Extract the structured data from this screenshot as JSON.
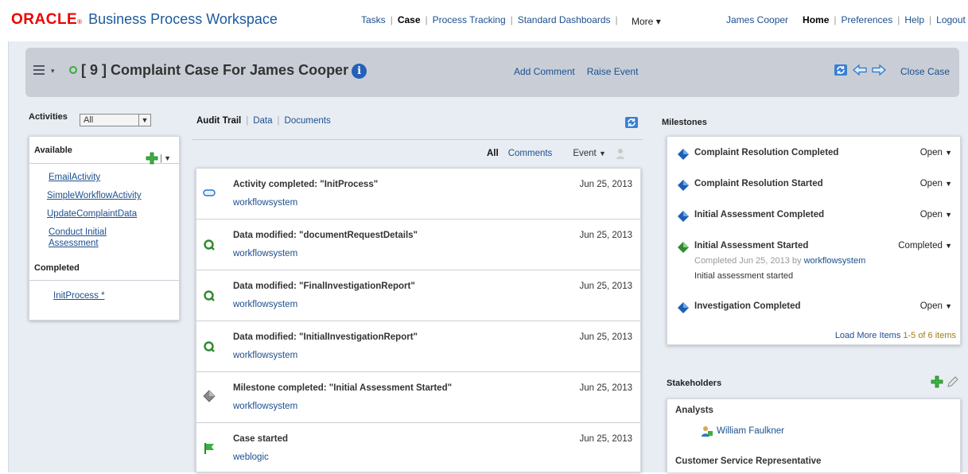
{
  "brand": {
    "oracle": "ORACLE",
    "product": "Business Process Workspace",
    "oracle_color": "#e00000"
  },
  "topnav": {
    "items": [
      "Tasks",
      "Case",
      "Process Tracking",
      "Standard Dashboards"
    ],
    "active": "Case",
    "more": "More"
  },
  "usernav": {
    "user": "James Cooper",
    "links": [
      "Home",
      "Preferences",
      "Help",
      "Logout"
    ]
  },
  "case": {
    "title": "[ 9 ] Complaint Case For James Cooper",
    "add_comment": "Add Comment",
    "raise_event": "Raise Event",
    "close_case": "Close Case"
  },
  "activities": {
    "label": "Activities",
    "filter": "All",
    "available_label": "Available",
    "available": [
      "EmailActivity",
      "SimpleWorkflowActivity",
      "UpdateComplaintData",
      "Conduct Initial Assessment"
    ],
    "completed_label": "Completed",
    "completed": [
      "InitProcess *"
    ]
  },
  "audit": {
    "tabs": [
      "Audit Trail",
      "Data",
      "Documents"
    ],
    "filters": {
      "all": "All",
      "comments": "Comments",
      "event": "Event"
    },
    "rows": [
      {
        "title": "Activity completed: \"InitProcess\"",
        "user": "workflowsystem",
        "date": "Jun 25, 2013",
        "icon": "activity-icon"
      },
      {
        "title": "Data modified: \"documentRequestDetails\"",
        "user": "workflowsystem",
        "date": "Jun 25, 2013",
        "icon": "data-modified-icon"
      },
      {
        "title": "Data modified: \"FinalInvestigationReport\"",
        "user": "workflowsystem",
        "date": "Jun 25, 2013",
        "icon": "data-modified-icon"
      },
      {
        "title": "Data modified: \"InitialInvestigationReport\"",
        "user": "workflowsystem",
        "date": "Jun 25, 2013",
        "icon": "data-modified-icon"
      },
      {
        "title": "Milestone completed: \"Initial Assessment Started\"",
        "user": "workflowsystem",
        "date": "Jun 25, 2013",
        "icon": "milestone-icon"
      },
      {
        "title": "Case started",
        "user": "weblogic",
        "date": "Jun 25, 2013",
        "icon": "flag-icon"
      }
    ]
  },
  "milestones": {
    "label": "Milestones",
    "items": [
      {
        "name": "Complaint Resolution Completed",
        "status": "Open"
      },
      {
        "name": "Complaint Resolution Started",
        "status": "Open"
      },
      {
        "name": "Initial Assessment Completed",
        "status": "Open"
      },
      {
        "name": "Initial Assessment Started",
        "status": "Completed",
        "detail_prefix": "Completed Jun 25, 2013 by",
        "detail_user": "workflowsystem",
        "note": "Initial assessment started"
      },
      {
        "name": "Investigation Completed",
        "status": "Open"
      }
    ],
    "load_more": "Load More Items",
    "count": "1-5 of 6 items"
  },
  "stakeholders": {
    "label": "Stakeholders",
    "groups": [
      {
        "name": "Analysts",
        "members": [
          "William Faulkner"
        ]
      },
      {
        "name": "Customer Service Representative",
        "members": []
      }
    ]
  }
}
